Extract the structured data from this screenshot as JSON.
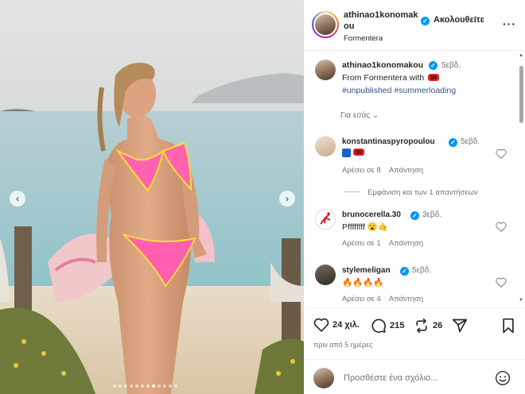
{
  "post": {
    "username": "athinao1konomakou",
    "username_wrapped_line1": "athinao1konomak",
    "username_wrapped_line2": "ou",
    "follow_label": "Ακολουθείτε",
    "more_label": "···",
    "location": "Formentera",
    "caption_time": "5εβδ.",
    "caption_text": "From Formentera with",
    "hashtags": [
      "#unpublished",
      "#summerloading"
    ],
    "for_you_label": "Για εσάς",
    "carousel_dots": 12,
    "carousel_active_index": 7
  },
  "comments": [
    {
      "username": "konstantinaspyropoulou",
      "time": "5εβδ.",
      "text": "",
      "likes_label": "Αρέσει σε 8",
      "reply_label": "Απάντηση",
      "view_replies_label": "Εμφάνιση και των 1 απαντήσεων"
    },
    {
      "username": "brunocerella.30",
      "time": "3εβδ.",
      "text": "Pffffffff 😮🤙",
      "likes_label": "Αρέσει σε 1",
      "reply_label": "Απάντηση"
    },
    {
      "username": "stylemeligan",
      "time": "5εβδ.",
      "text": "🔥🔥🔥🔥",
      "likes_label": "Αρέσει σε 4",
      "reply_label": "Απάντηση"
    }
  ],
  "actions": {
    "likes": "24 χιλ.",
    "comments": "215",
    "reposts": "26",
    "posted_ago": "πριν από 5 ημέρες"
  },
  "add_comment": {
    "placeholder": "Προσθέστε ένα σχόλιο..."
  },
  "colors": {
    "verified": "#0095f6",
    "hashtag": "#00376b",
    "secondary_text": "#737373"
  }
}
